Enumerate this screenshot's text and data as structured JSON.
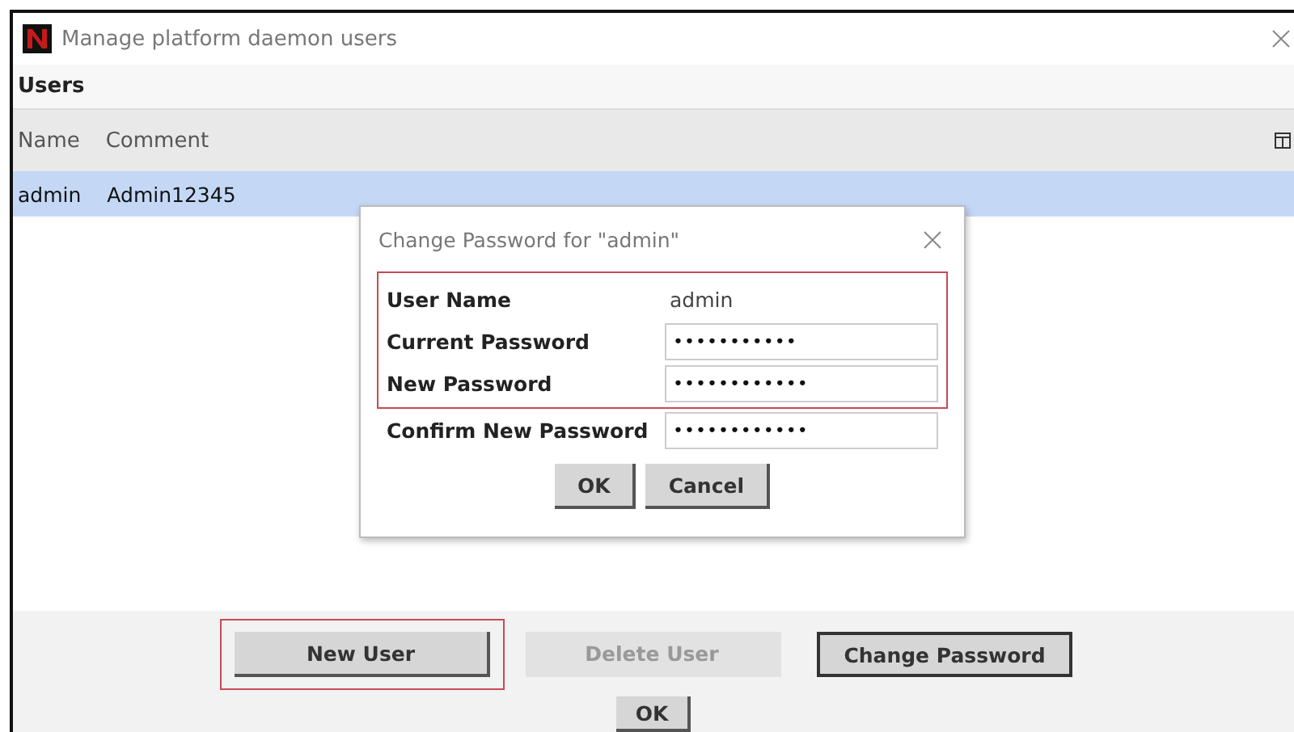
{
  "window": {
    "title": "Manage platform daemon users"
  },
  "section_title": "Users",
  "table": {
    "columns": [
      "Name",
      "Comment"
    ],
    "rows": [
      {
        "cells": [
          "admin",
          "Admin12345"
        ],
        "selected": true
      }
    ]
  },
  "dialog": {
    "title": "Change Password for \"admin\"",
    "fields": [
      {
        "kind": "text",
        "label": "User Name",
        "value": "admin",
        "highlighted": true
      },
      {
        "kind": "password",
        "label": "Current Password",
        "value": "•••••••••••",
        "highlighted": true
      },
      {
        "kind": "password",
        "label": "New Password",
        "value": "••••••••••••",
        "highlighted": true
      },
      {
        "kind": "password",
        "label": "Confirm New Password",
        "value": "••••••••••••",
        "highlighted": false
      }
    ],
    "buttons": [
      {
        "label": "OK"
      },
      {
        "label": "Cancel"
      }
    ]
  },
  "buttons": [
    {
      "label": "New User",
      "disabled": false,
      "highlighted": true,
      "focused": false
    },
    {
      "label": "Delete User",
      "disabled": true,
      "highlighted": false,
      "focused": false
    },
    {
      "label": "Change Password",
      "disabled": false,
      "highlighted": false,
      "focused": true
    }
  ],
  "ok_button": {
    "label": "OK"
  }
}
